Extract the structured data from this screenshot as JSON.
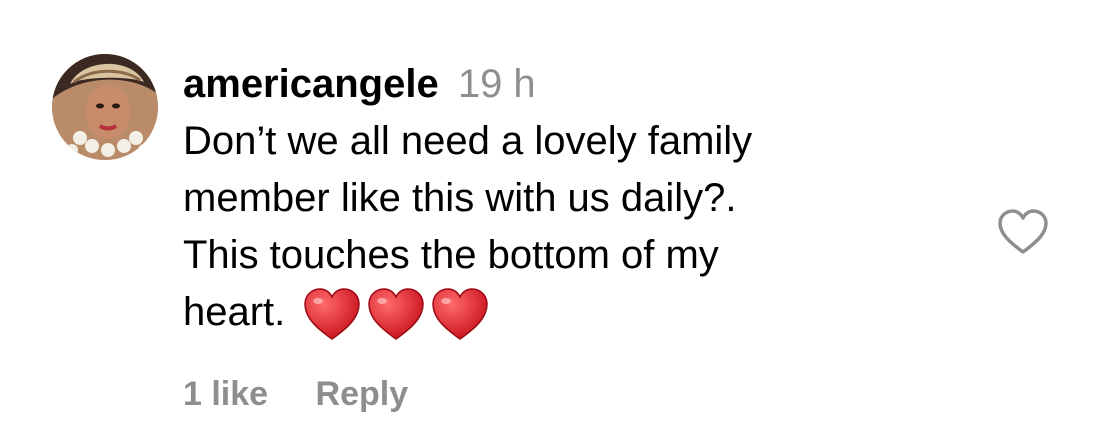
{
  "comment": {
    "username": "americangele",
    "timestamp": "19 h",
    "text_lines": [
      "Don’t we all need a lovely family",
      "member like this with us daily?.",
      "This touches the bottom of my",
      "heart."
    ],
    "emoji": [
      "red-heart",
      "red-heart",
      "red-heart"
    ],
    "likes_label": "1 like",
    "reply_label": "Reply"
  },
  "colors": {
    "text": "#000000",
    "muted": "#8e8e8e",
    "heart_red": "#e0242c",
    "like_outline": "#8e8e8e"
  },
  "icons": {
    "avatar": "profile-photo",
    "like": "heart-outline-icon"
  }
}
